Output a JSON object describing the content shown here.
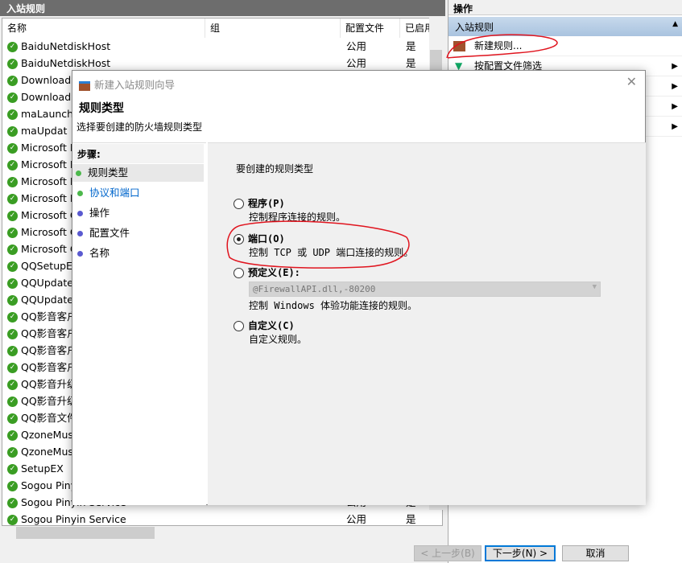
{
  "left_panel": {
    "title": "入站规则",
    "columns": [
      "名称",
      "组",
      "配置文件",
      "已启用"
    ],
    "rows": [
      {
        "name": "BaiduNetdiskHost",
        "profile": "公用",
        "enabled": "是"
      },
      {
        "name": "BaiduNetdiskHost",
        "profile": "公用",
        "enabled": "是"
      },
      {
        "name": "DownloadS",
        "profile": "",
        "enabled": ""
      },
      {
        "name": "DownloadS",
        "profile": "",
        "enabled": ""
      },
      {
        "name": "maLaunche",
        "profile": "",
        "enabled": ""
      },
      {
        "name": "maUpdat",
        "profile": "",
        "enabled": ""
      },
      {
        "name": "Microsoft L",
        "profile": "",
        "enabled": ""
      },
      {
        "name": "Microsoft L",
        "profile": "",
        "enabled": ""
      },
      {
        "name": "Microsoft L",
        "profile": "",
        "enabled": ""
      },
      {
        "name": "Microsoft L",
        "profile": "",
        "enabled": ""
      },
      {
        "name": "Microsoft C",
        "profile": "",
        "enabled": ""
      },
      {
        "name": "Microsoft C",
        "profile": "",
        "enabled": ""
      },
      {
        "name": "Microsoft C",
        "profile": "",
        "enabled": ""
      },
      {
        "name": "QQSetupEX",
        "profile": "",
        "enabled": ""
      },
      {
        "name": "QQUpdate",
        "profile": "",
        "enabled": ""
      },
      {
        "name": "QQUpdate",
        "profile": "",
        "enabled": ""
      },
      {
        "name": "QQ影音客户",
        "profile": "",
        "enabled": ""
      },
      {
        "name": "QQ影音客户",
        "profile": "",
        "enabled": ""
      },
      {
        "name": "QQ影音客户",
        "profile": "",
        "enabled": ""
      },
      {
        "name": "QQ影音客户",
        "profile": "",
        "enabled": ""
      },
      {
        "name": "QQ影音升级",
        "profile": "",
        "enabled": ""
      },
      {
        "name": "QQ影音升级",
        "profile": "",
        "enabled": ""
      },
      {
        "name": "QQ影音文件",
        "profile": "",
        "enabled": ""
      },
      {
        "name": "QzoneMus",
        "profile": "",
        "enabled": ""
      },
      {
        "name": "QzoneMus",
        "profile": "",
        "enabled": ""
      },
      {
        "name": "SetupEX",
        "profile": "",
        "enabled": ""
      },
      {
        "name": "Sogou Pinyin",
        "profile": "",
        "enabled": ""
      },
      {
        "name": "Sogou Pinyin Service",
        "profile": "公用",
        "enabled": "是"
      },
      {
        "name": "Sogou Pinyin Service",
        "profile": "公用",
        "enabled": "是"
      }
    ]
  },
  "actions": {
    "title": "操作",
    "section": "入站规则",
    "items": [
      "新建规则...",
      "按配置文件筛选"
    ]
  },
  "dialog": {
    "title": "新建入站规则向导",
    "heading": "规则类型",
    "subtitle": "选择要创建的防火墙规则类型",
    "steps_title": "步骤:",
    "steps": [
      "规则类型",
      "协议和端口",
      "操作",
      "配置文件",
      "名称"
    ],
    "prompt": "要创建的规则类型",
    "options": [
      {
        "label": "程序(P)",
        "desc": "控制程序连接的规则。",
        "selected": false
      },
      {
        "label": "端口(O)",
        "desc": "控制 TCP 或 UDP 端口连接的规则。",
        "selected": true
      },
      {
        "label": "预定义(E):",
        "desc": "控制 Windows 体验功能连接的规则。",
        "selected": false,
        "dropdown": "@FirewallAPI.dll,-80200"
      },
      {
        "label": "自定义(C)",
        "desc": "自定义规则。",
        "selected": false
      }
    ],
    "buttons": {
      "back": "< 上一步(B)",
      "next": "下一步(N) >",
      "cancel": "取消"
    }
  },
  "colors": {
    "accent": "#0078d7",
    "annotation": "#e0141e",
    "check": "#3a9d23"
  }
}
